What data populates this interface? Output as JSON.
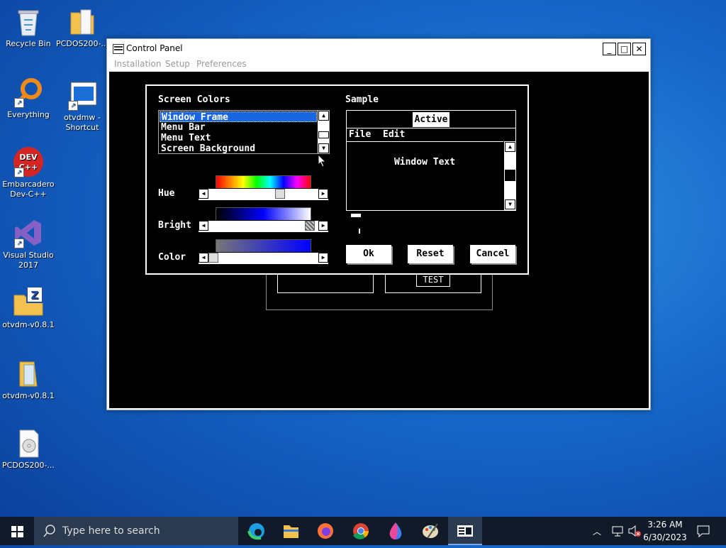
{
  "desktop": {
    "icons": [
      {
        "label": "Recycle Bin"
      },
      {
        "label": "PCDOS200-..."
      },
      {
        "label": "Everything"
      },
      {
        "label": "otvdmw - Shortcut"
      },
      {
        "label": "Embarcadero Dev-C++"
      },
      {
        "label": "Visual Studio 2017"
      },
      {
        "label": "otvdm-v0.8.1"
      },
      {
        "label": "otvdm-v0.8.1"
      },
      {
        "label": "PCDOS200-..."
      }
    ]
  },
  "window": {
    "title": "Control Panel",
    "menu": [
      "Installation",
      "Setup",
      "Preferences"
    ],
    "min_label": "_",
    "max_label": "□",
    "close_label": "✕"
  },
  "dialog": {
    "screen_colors_label": "Screen Colors",
    "sample_label": "Sample",
    "list_items": [
      "Window Frame",
      "Menu Bar",
      "Menu Text",
      "Screen Background"
    ],
    "selected_item": "Window Frame",
    "sliders": {
      "hue": {
        "label": "Hue",
        "value": 0.8
      },
      "bright": {
        "label": "Bright",
        "value": 1.0
      },
      "color": {
        "label": "Color",
        "value": 0.0
      }
    },
    "sample": {
      "active_title": "Active",
      "menu_file": "File",
      "menu_edit": "Edit",
      "window_text": "Window Text"
    },
    "buttons": {
      "ok": "Ok",
      "reset": "Reset",
      "cancel": "Cancel"
    }
  },
  "background_label": "TEST",
  "taskbar": {
    "search_placeholder": "Type here to search",
    "time": "3:26 AM",
    "date": "6/30/2023"
  },
  "colors": {
    "selection": "#1a66e0",
    "client_bg": "#000000",
    "taskbar": "#101a28"
  }
}
